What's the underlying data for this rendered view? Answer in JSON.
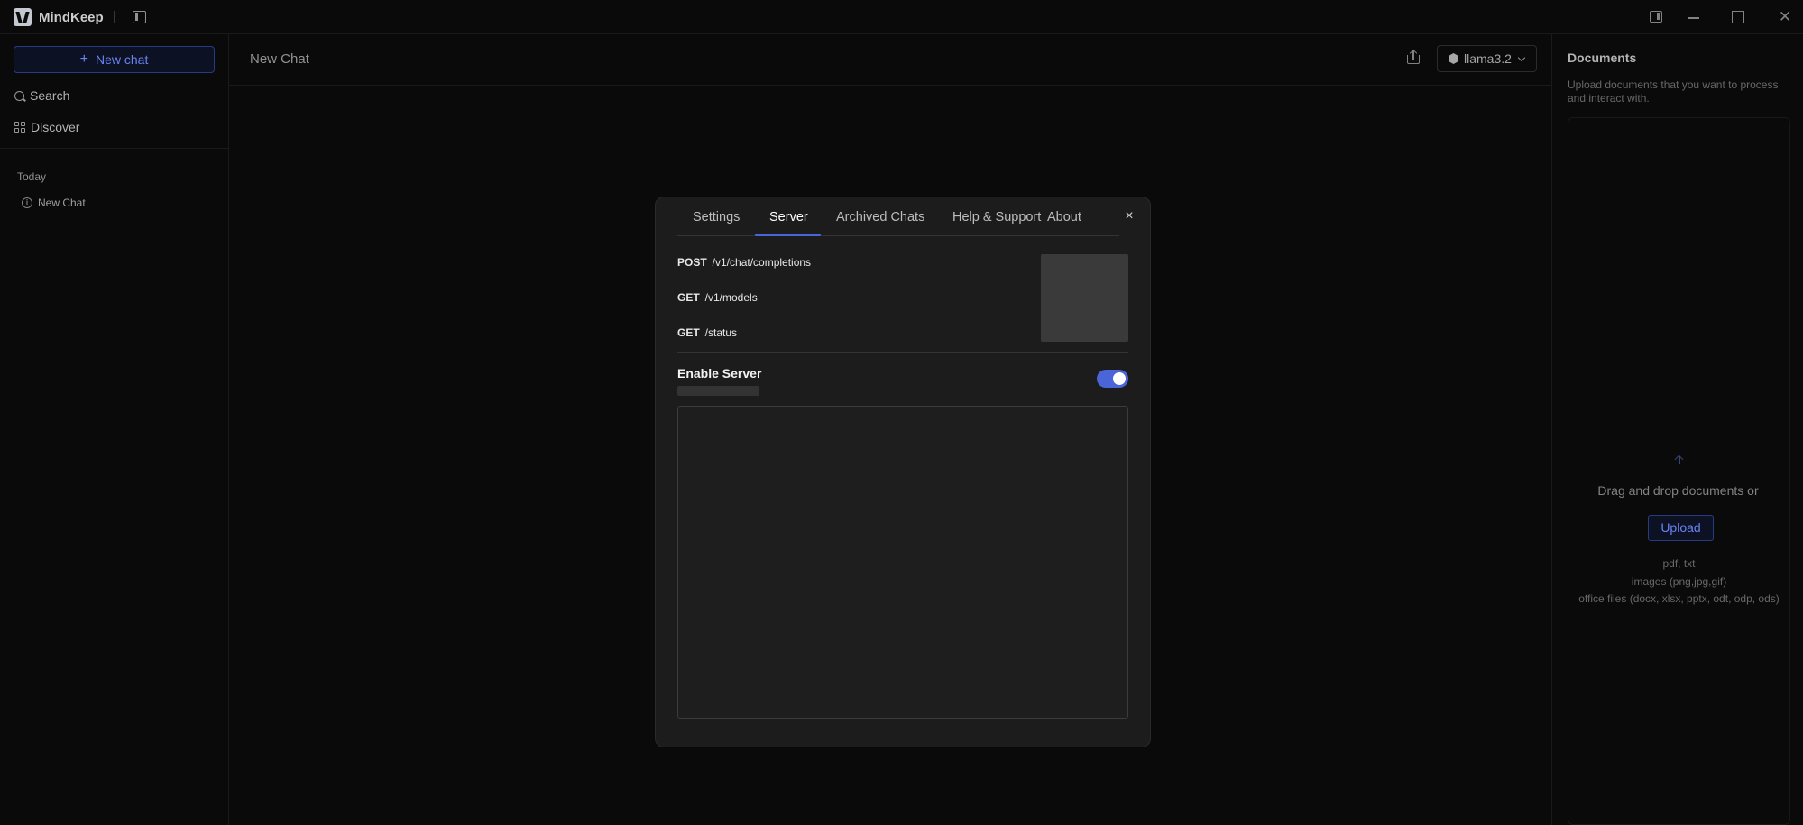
{
  "app": {
    "name": "MindKeep"
  },
  "sidebar": {
    "new_chat_label": "New chat",
    "search_label": "Search",
    "discover_label": "Discover",
    "section_today": "Today",
    "history": [
      {
        "label": "New Chat"
      }
    ]
  },
  "main": {
    "chat_title": "New Chat",
    "model": "llama3.2"
  },
  "documents": {
    "title": "Documents",
    "description": "Upload documents that you want to process and interact with.",
    "drop_text": "Drag and drop documents or",
    "upload_label": "Upload",
    "formats": [
      "pdf, txt",
      "images (png,jpg,gif)",
      "office files (docx, xlsx, pptx, odt, odp, ods)"
    ]
  },
  "modal": {
    "tabs": [
      {
        "label": "Settings",
        "active": false
      },
      {
        "label": "Server",
        "active": true
      },
      {
        "label": "Archived Chats",
        "active": false
      },
      {
        "label": "Help & Support",
        "active": false
      },
      {
        "label": "About",
        "active": false
      }
    ],
    "close_label": "×",
    "endpoints": [
      {
        "method": "POST",
        "path": "/v1/chat/completions"
      },
      {
        "method": "GET",
        "path": "/v1/models"
      },
      {
        "method": "GET",
        "path": "/status"
      }
    ],
    "enable_server_label": "Enable Server",
    "enable_server_on": true
  },
  "colors": {
    "accent": "#4a65d8",
    "accent_text": "#6f8cff",
    "background": "#0b0b0b",
    "modal_bg": "#1c1c1c"
  }
}
